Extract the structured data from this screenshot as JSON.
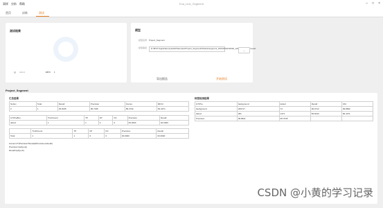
{
  "menu": [
    "采样",
    "分析",
    "帮助"
  ],
  "app_title": "Eva_Line_Segment",
  "window_controls": [
    "minimize-icon",
    "maximize-icon",
    "close-icon"
  ],
  "tabs": [
    {
      "label": "首页"
    },
    {
      "label": "训练"
    },
    {
      "label": "测试"
    }
  ],
  "result_card": {
    "title": "测试结果",
    "legend_label": "defect",
    "legend_pct": "100%",
    "legend_count": "1"
  },
  "model_card": {
    "title": "模型",
    "name_label": "模型名称",
    "name_value": "Project_Segment",
    "path_label": "模型路径",
    "path_value": "D:/MVIT/Application/yasdt4/Samples/Project_Segment/Models/segment_20231031152530_100_best.onnxt/model",
    "dots": "...",
    "btn_left": "导出报告",
    "btn_right": "开始测试"
  },
  "project_label": "Project_Segment",
  "left_table_title": "汇总结果",
  "summary_table": {
    "header": [
      "Nobox",
      "Total",
      "Recall",
      "Precision",
      "Fscore",
      "MIOU"
    ],
    "rows": [
      [
        "2",
        "1",
        "93.0045",
        "95.7045",
        "89.3732",
        "82.4371"
      ]
    ]
  },
  "defect_table": {
    "header": [
      "GT/PreBox",
      "TruthCount",
      "TP",
      "FP",
      "FN",
      "Precision",
      "Recall"
    ],
    "rows": [
      [
        "defect",
        "1",
        "1",
        "0",
        "0",
        "00.0000",
        "00.0000"
      ]
    ]
  },
  "total_table": {
    "header": [
      "",
      "TruthCount",
      "TP",
      "FP",
      "FN",
      "Precision",
      "Recall"
    ],
    "rows": [
      [
        "Total",
        "1",
        "1",
        "0",
        "0",
        "00.0000",
        "00.0000"
      ]
    ]
  },
  "formulas": [
    "Fscore=2*(Precision*Recall)/(Precision+Recall)",
    "Precision=tp/(tp+fp)",
    "Recall=tp/(tp+fn)"
  ],
  "right_table_title": "标签检测结果",
  "class_table": {
    "header": [
      "GT/Pre",
      "background",
      "defect",
      "Recall",
      "IOU"
    ],
    "rows": [
      [
        "background",
        "200717",
        "72",
        "99.9712",
        "99.8832"
      ],
      [
        "defect",
        "281",
        "1471",
        "83.6043",
        "82.4371"
      ],
      [
        "Precision",
        "99.8921",
        "95.7045",
        "",
        ""
      ]
    ]
  },
  "watermark": "CSDN @小黄的学习记录"
}
